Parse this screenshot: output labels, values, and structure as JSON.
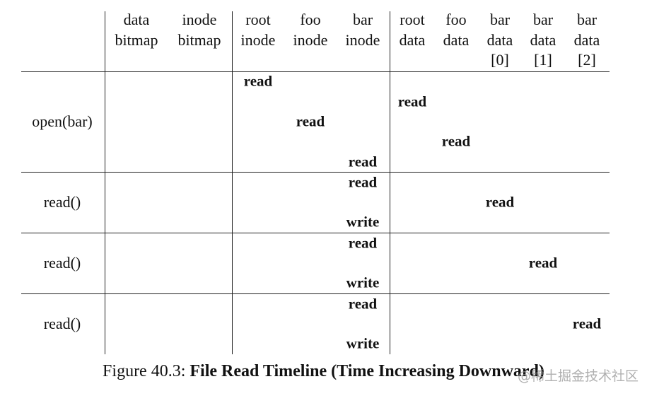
{
  "columns": [
    {
      "lines": [
        "data",
        "bitmap"
      ]
    },
    {
      "lines": [
        "inode",
        "bitmap"
      ]
    },
    {
      "lines": [
        "root",
        "inode"
      ]
    },
    {
      "lines": [
        "foo",
        "inode"
      ]
    },
    {
      "lines": [
        "bar",
        "inode"
      ]
    },
    {
      "lines": [
        "root",
        "data"
      ]
    },
    {
      "lines": [
        "foo",
        "data"
      ]
    },
    {
      "lines": [
        "bar",
        "data",
        "[0]"
      ]
    },
    {
      "lines": [
        "bar",
        "data",
        "[1]"
      ]
    },
    {
      "lines": [
        "bar",
        "data",
        "[2]"
      ]
    }
  ],
  "rows": [
    {
      "label": "open(bar)",
      "events": [
        {
          "column": "root inode",
          "text": "read"
        },
        {
          "column": "root data",
          "text": "read"
        },
        {
          "column": "foo inode",
          "text": "read"
        },
        {
          "column": "foo data",
          "text": "read"
        },
        {
          "column": "bar inode",
          "text": "read"
        }
      ]
    },
    {
      "label": "read()",
      "events": [
        {
          "column": "bar inode",
          "text": "read"
        },
        {
          "column": "bar data [0]",
          "text": "read"
        },
        {
          "column": "bar inode",
          "text": "write"
        }
      ]
    },
    {
      "label": "read()",
      "events": [
        {
          "column": "bar inode",
          "text": "read"
        },
        {
          "column": "bar data [1]",
          "text": "read"
        },
        {
          "column": "bar inode",
          "text": "write"
        }
      ]
    },
    {
      "label": "read()",
      "events": [
        {
          "column": "bar inode",
          "text": "read"
        },
        {
          "column": "bar data [2]",
          "text": "read"
        },
        {
          "column": "bar inode",
          "text": "write"
        }
      ]
    }
  ],
  "caption": {
    "prefix": "Figure 40.3: ",
    "title": "File Read Timeline (Time Increasing Downward)"
  },
  "watermark": "@稀土掘金技术社区"
}
